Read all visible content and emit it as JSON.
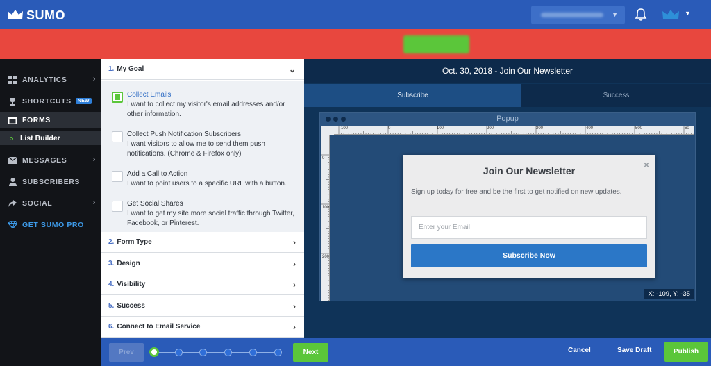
{
  "header": {
    "logo_text": "SUMO",
    "account_value": "",
    "icons": {
      "logo": "crown-icon",
      "notifications": "bell-icon",
      "user": "crown-avatar-icon",
      "menu": "chevron-down-icon"
    }
  },
  "banner": {
    "text": "",
    "button_label": ""
  },
  "sidebar": {
    "items": [
      {
        "label": "ANALYTICS",
        "icon": "grid-icon",
        "has_chevron": true
      },
      {
        "label": "SHORTCUTS",
        "icon": "trophy-icon",
        "badge": "NEW"
      },
      {
        "label": "FORMS",
        "icon": "window-icon",
        "active": true
      },
      {
        "label": "List Builder",
        "sub": true
      },
      {
        "label": "MESSAGES",
        "icon": "envelope-icon",
        "has_chevron": true
      },
      {
        "label": "SUBSCRIBERS",
        "icon": "person-icon"
      },
      {
        "label": "SOCIAL",
        "icon": "share-icon",
        "has_chevron": true
      },
      {
        "label": "GET SUMO PRO",
        "icon": "diamond-icon"
      }
    ]
  },
  "steps": {
    "items": [
      {
        "num": "1.",
        "label": "My Goal"
      },
      {
        "num": "2.",
        "label": "Form Type"
      },
      {
        "num": "3.",
        "label": "Design"
      },
      {
        "num": "4.",
        "label": "Visibility"
      },
      {
        "num": "5.",
        "label": "Success"
      },
      {
        "num": "6.",
        "label": "Connect to Email Service"
      }
    ],
    "goals": [
      {
        "title": "Collect Emails",
        "desc": "I want to collect my visitor's email addresses and/or other information.",
        "checked": true
      },
      {
        "title": "Collect Push Notification Subscribers",
        "desc": "I want visitors to allow me to send them push notifications. (Chrome & Firefox only)",
        "checked": false
      },
      {
        "title": "Add a Call to Action",
        "desc": "I want to point users to a specific URL with a button.",
        "checked": false
      },
      {
        "title": "Get Social Shares",
        "desc": "I want to get my site more social traffic through Twitter, Facebook, or Pinterest.",
        "checked": false
      }
    ]
  },
  "preview": {
    "title": "Oct. 30, 2018 - Join Our Newsletter",
    "tabs": [
      "Subscribe",
      "Success"
    ],
    "window_title": "Popup",
    "ruler_h": [
      "-100",
      "0",
      "100",
      "200",
      "300",
      "400",
      "500",
      "60"
    ],
    "ruler_v": [
      "0",
      "100",
      "200"
    ],
    "coords": "X: -109, Y: -35",
    "popup": {
      "close": "×",
      "title": "Join Our Newsletter",
      "text": "Sign up today for free and be the first to get notified on new updates.",
      "input_placeholder": "Enter your Email",
      "button_label": "Subscribe Now"
    }
  },
  "footer": {
    "prev_label": "Prev",
    "next_label": "Next",
    "cancel_label": "Cancel",
    "draft_label": "Save Draft",
    "publish_label": "Publish",
    "progress": {
      "current_step": 1,
      "total_steps": 6
    }
  },
  "colors": {
    "header": "#2a5bb8",
    "banner": "#e8473e",
    "accent_green": "#5bc63a",
    "sidebar": "#121418",
    "preview_bg": "#0f3358",
    "popup_button": "#2b77c7"
  }
}
